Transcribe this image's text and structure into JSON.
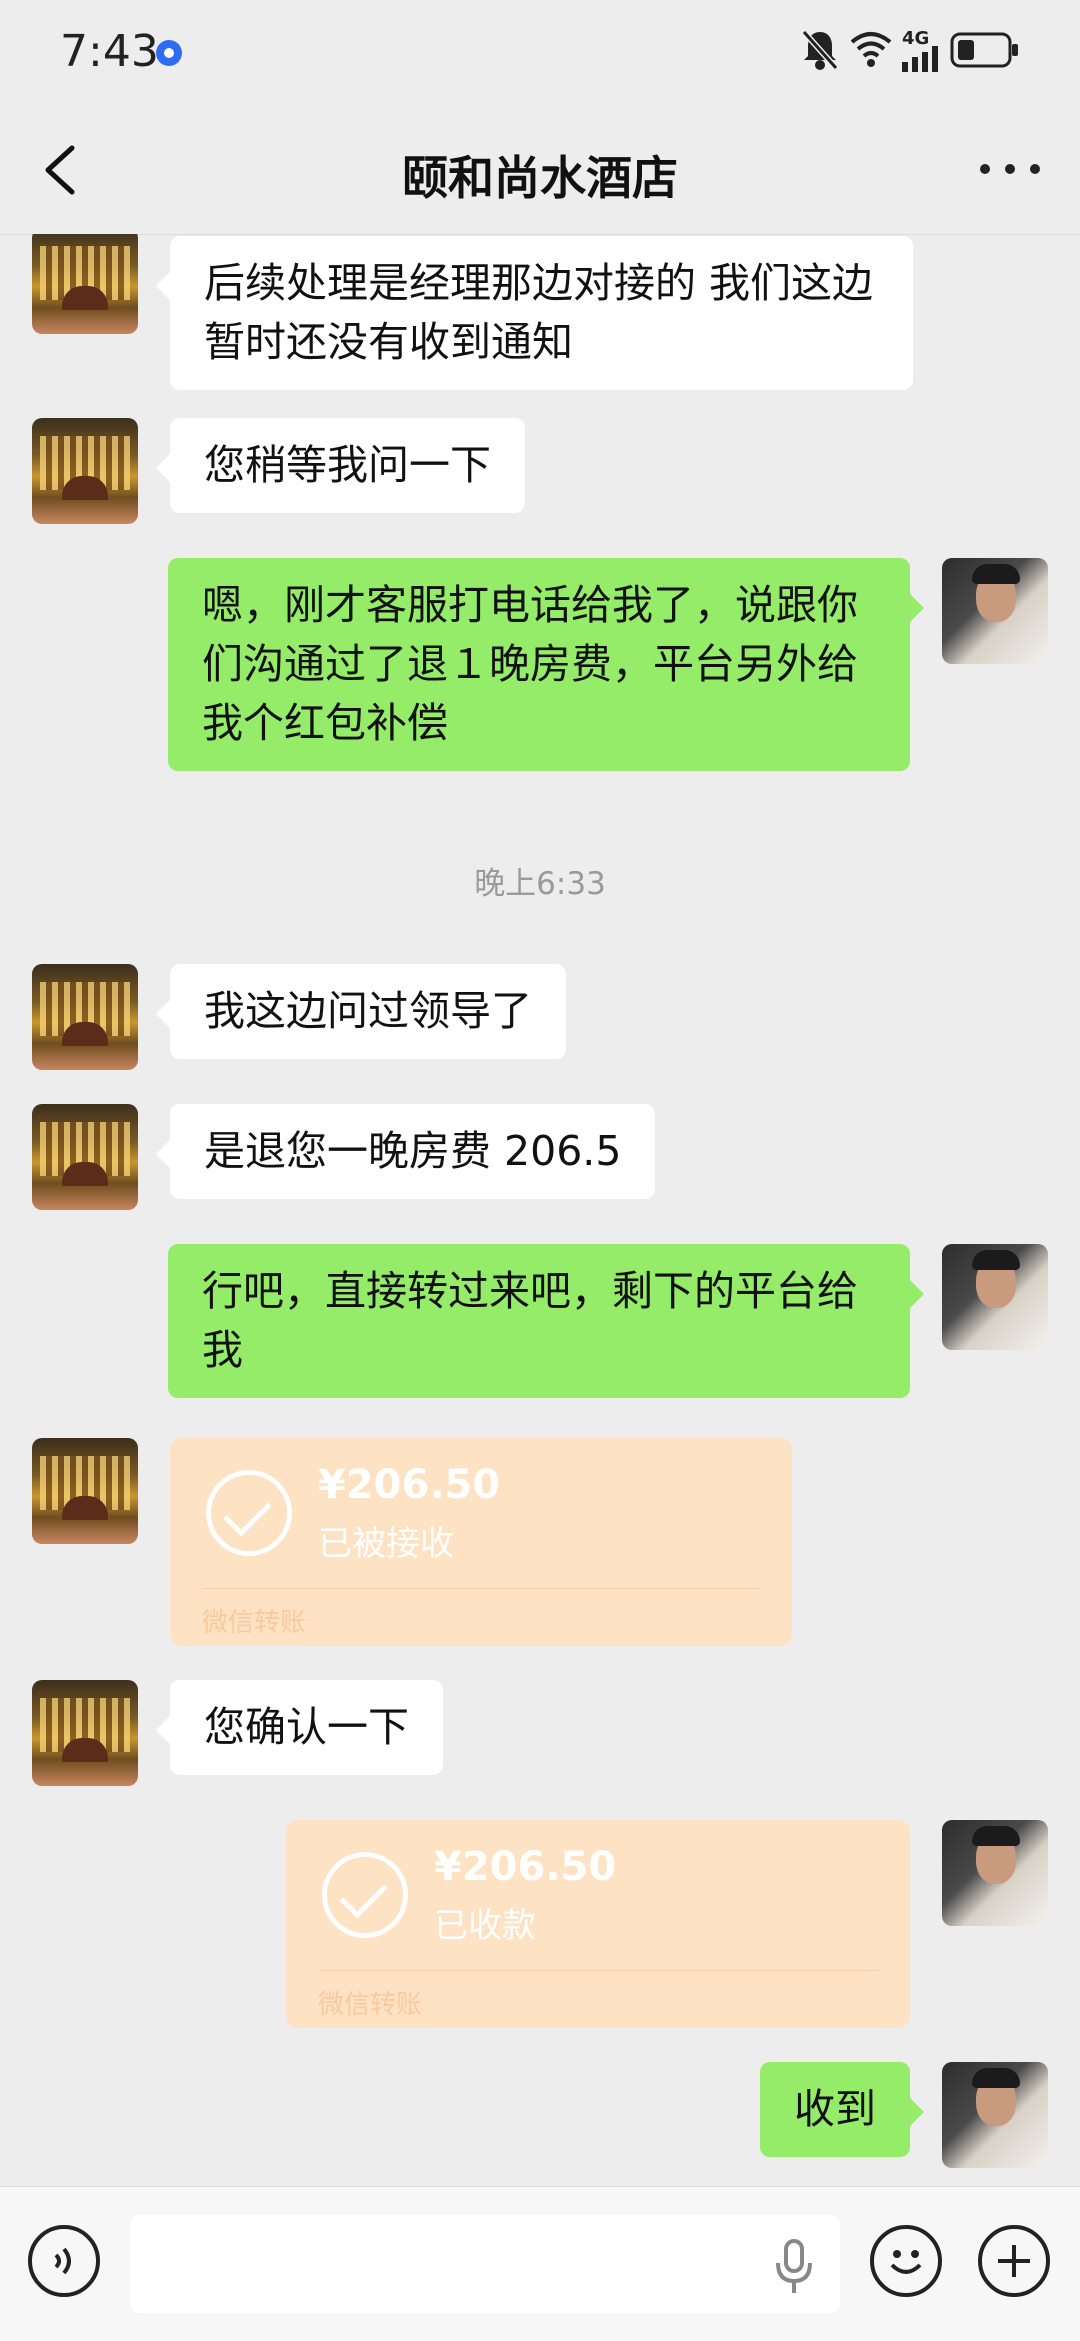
{
  "status_bar": {
    "time": "7:43",
    "network": "4G",
    "icons": [
      "location-icon",
      "mute-icon",
      "wifi-icon",
      "signal-icon",
      "battery-icon"
    ]
  },
  "header": {
    "title": "颐和尚水酒店",
    "icons": [
      "back-chevron-icon",
      "more-dots-icon"
    ]
  },
  "messages": [
    {
      "from": "hotel",
      "text": "后续处理是经理那边对接的 我们这边暂时还没有收到通知"
    },
    {
      "from": "hotel",
      "text": "您稍等我问一下"
    },
    {
      "from": "me",
      "text": "嗯，刚才客服打电话给我了，说跟你们沟通过了退１晚房费，平台另外给我个红包补偿"
    },
    {
      "timestamp": "晚上6:33"
    },
    {
      "from": "hotel",
      "text": "我这边问过领导了"
    },
    {
      "from": "hotel",
      "text": "是退您一晚房费 206.5"
    },
    {
      "from": "me",
      "text": "行吧，直接转过来吧，剩下的平台给我"
    },
    {
      "from": "hotel",
      "transfer": {
        "amount": "¥206.50",
        "status": "已被接收",
        "label": "微信转账"
      }
    },
    {
      "from": "hotel",
      "text": "您确认一下"
    },
    {
      "from": "me",
      "transfer": {
        "amount": "¥206.50",
        "status": "已收款",
        "label": "微信转账"
      }
    },
    {
      "from": "me",
      "text": "收到"
    }
  ],
  "input_bar": {
    "placeholder": "",
    "icons": [
      "voice-mode-icon",
      "microphone-icon",
      "emoji-icon",
      "plus-icon"
    ]
  },
  "colors": {
    "background": "#ededed",
    "sent_bubble": "#95ec69",
    "received_bubble": "#ffffff",
    "transfer_card": "#fde2c4"
  }
}
